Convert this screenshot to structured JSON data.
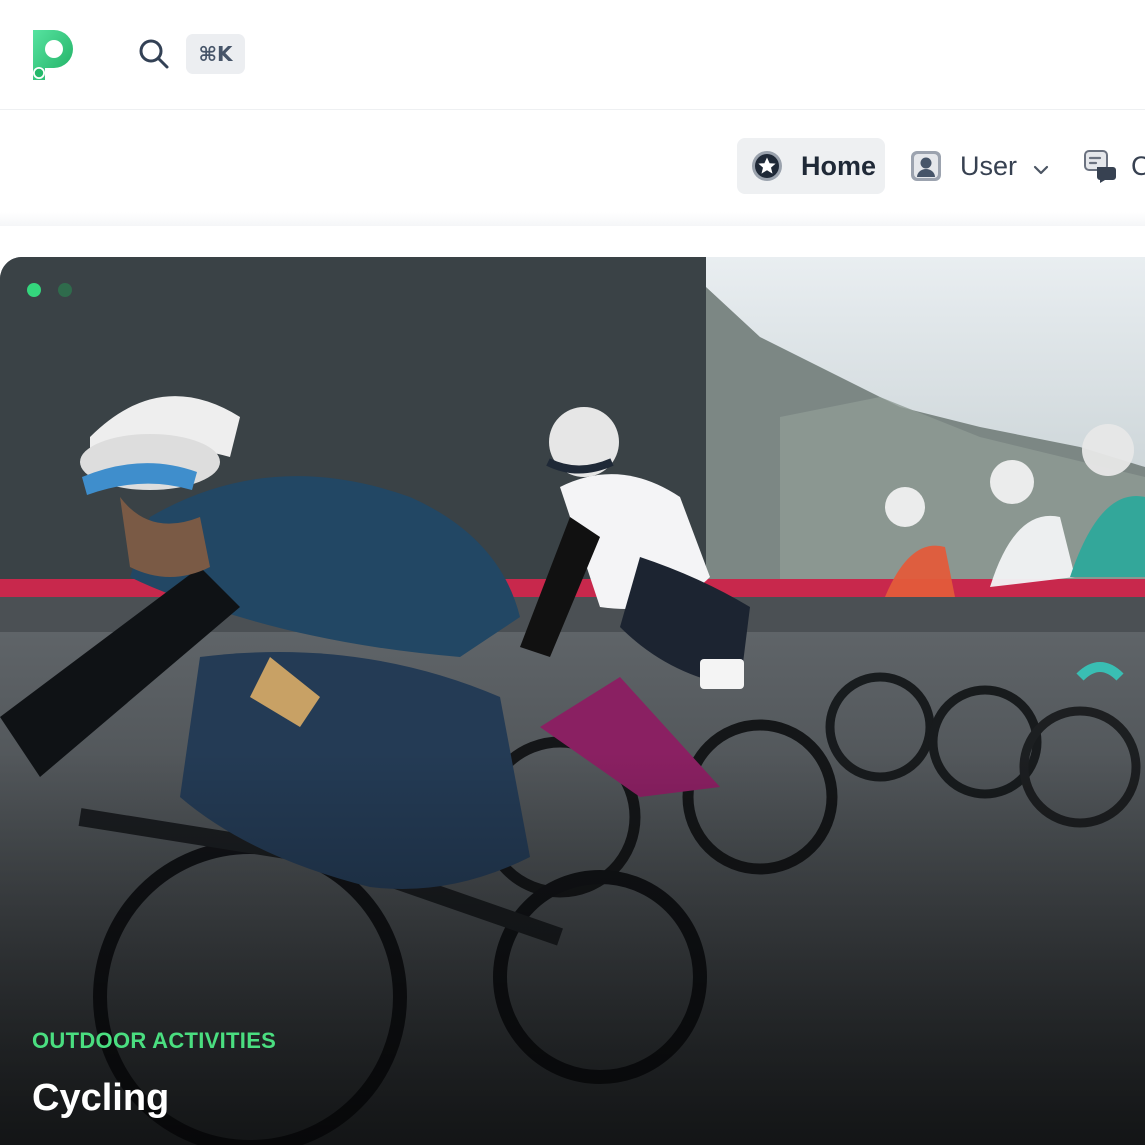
{
  "header": {
    "logo_icon": "p-logo-icon",
    "search_icon": "search-icon",
    "shortcut": "⌘K"
  },
  "nav": {
    "items": [
      {
        "label": "Home",
        "icon": "star-icon",
        "active": true
      },
      {
        "label": "User",
        "icon": "user-icon",
        "has_dropdown": true
      },
      {
        "label": "C",
        "icon": "chat-icon"
      }
    ]
  },
  "hero": {
    "category": "OUTDOOR ACTIVITIES",
    "title": "Cycling",
    "slides_total": 2,
    "active_slide": 1,
    "accent_color": "#4ade80"
  }
}
